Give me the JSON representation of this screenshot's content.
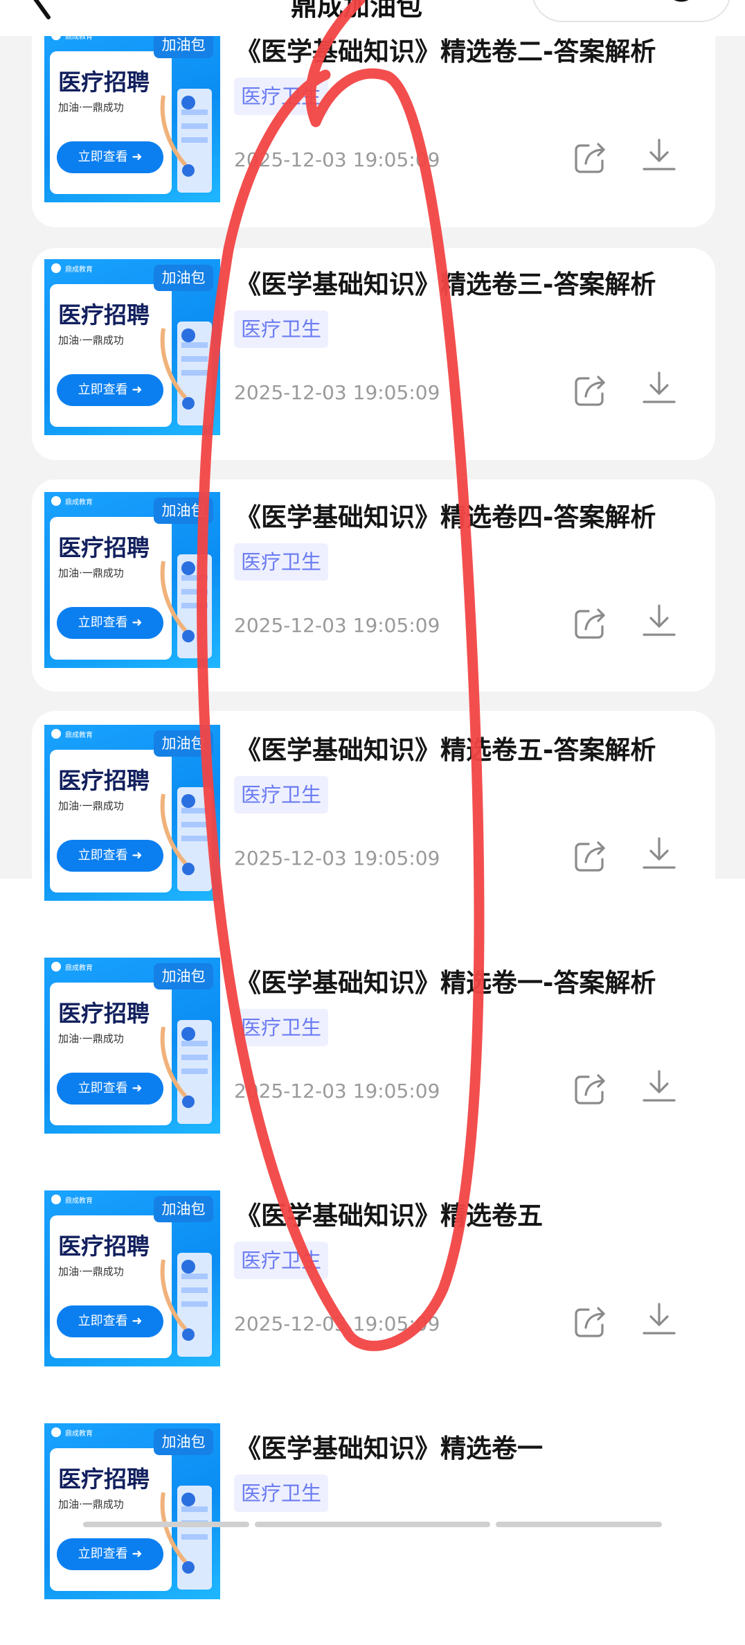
{
  "header": {
    "title": "鼎成加油包"
  },
  "items": [
    {
      "title": "《医学基础知识》精选卷二-答案解析",
      "category": "医疗卫生",
      "date": "2025-12-03 19:05:09"
    },
    {
      "title": "《医学基础知识》精选卷三-答案解析",
      "category": "医疗卫生",
      "date": "2025-12-03 19:05:09"
    },
    {
      "title": "《医学基础知识》精选卷四-答案解析",
      "category": "医疗卫生",
      "date": "2025-12-03 19:05:09"
    },
    {
      "title": "《医学基础知识》精选卷五-答案解析",
      "category": "医疗卫生",
      "date": "2025-12-03 19:05:09"
    },
    {
      "title": "《医学基础知识》精选卷一-答案解析",
      "category": "医疗卫生",
      "date": "2025-12-03 19:05:09"
    },
    {
      "title": "《医学基础知识》精选卷五",
      "category": "医疗卫生",
      "date": "2025-12-03 19:05:09"
    },
    {
      "title": "《医学基础知识》精选卷一",
      "category": "医疗卫生",
      "date": ""
    }
  ],
  "thumbnail": {
    "badge": "加油包",
    "heading": "医疗招聘",
    "slogan": "加油·一鼎成功",
    "button": "立即查看 ➜",
    "brand": "鼎成教育"
  },
  "colors": {
    "accent": "#0b7ff0",
    "tag_text": "#6b7cf2",
    "tag_bg": "#eef0ff",
    "annotation": "#f24545"
  }
}
